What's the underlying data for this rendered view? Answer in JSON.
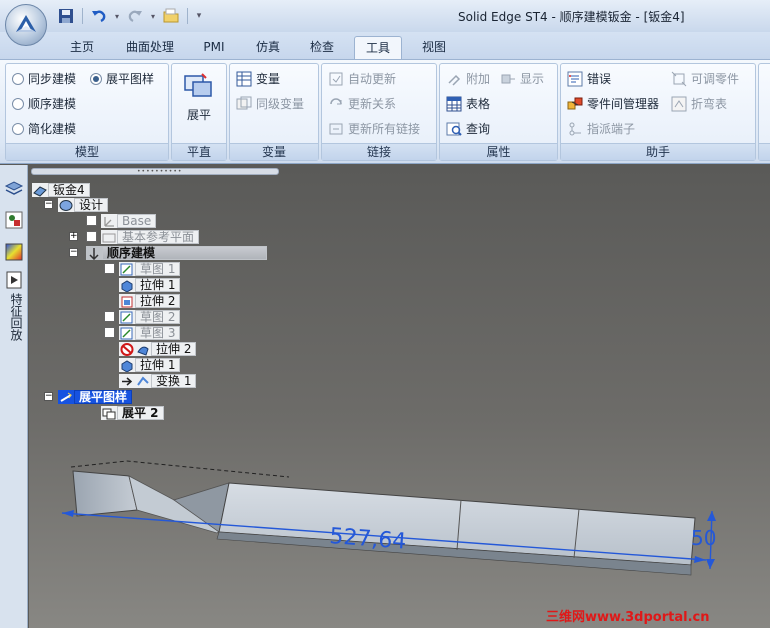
{
  "window": {
    "title": "Solid Edge ST4 - 顺序建模钣金 - [钣金4]"
  },
  "tabs": [
    {
      "label": "主页"
    },
    {
      "label": "曲面处理"
    },
    {
      "label": "PMI"
    },
    {
      "label": "仿真"
    },
    {
      "label": "检查"
    },
    {
      "label": "工具",
      "active": true
    },
    {
      "label": "视图"
    }
  ],
  "ribbon": {
    "model": {
      "label": "模型",
      "sync": "同步建模",
      "flat": "展平图样",
      "ordered": "顺序建模",
      "simplify": "简化建模",
      "selected": "flat"
    },
    "flatten": {
      "label": "平直",
      "button": "展平"
    },
    "variables": {
      "label": "变量",
      "var": "变量",
      "peer": "同级变量"
    },
    "links": {
      "label": "链接",
      "auto": "自动更新",
      "relations": "更新关系",
      "all": "更新所有链接"
    },
    "properties": {
      "label": "属性",
      "attach": "附加",
      "show": "显示",
      "table": "表格",
      "query": "查询"
    },
    "assistant": {
      "label": "助手",
      "error": "错误",
      "parts_manager": "零件间管理器",
      "assign_terminal": "指派端子",
      "adjustable": "可调零件",
      "bend_table": "折弯表"
    }
  },
  "pathfinder": {
    "side_label": "特征回放",
    "tree": {
      "root": "钣金4",
      "design": "设计",
      "base": "Base",
      "ref_planes": "基本参考平面",
      "ordered": "顺序建模",
      "sketch1": "草图 1",
      "extrude1a": "拉伸 1",
      "extrude2a": "拉伸 2",
      "sketch2": "草图 2",
      "sketch3": "草图 3",
      "extrude2b": "拉伸 2",
      "extrude1b": "拉伸 1",
      "transform1": "变换 1",
      "flat_pattern": "展平图样",
      "flatten2": "展平 2"
    }
  },
  "viewport": {
    "dim_length": "527,64",
    "dim_width": "50"
  },
  "watermark": "三维网www.3dportal.cn"
}
